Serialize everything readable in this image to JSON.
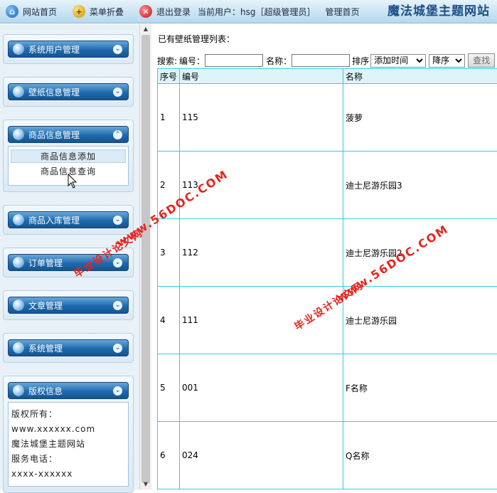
{
  "topbar": {
    "home_label": "网站首页",
    "fold_label": "菜单折叠",
    "logout_label": "退出登录",
    "current_user_label": "当前用户：hsg［超级管理员］",
    "admin_home_label": "管理首页",
    "site_title": "魔法城堡主题网站"
  },
  "sidebar": {
    "menus": [
      {
        "label": "系统用户管理"
      },
      {
        "label": "壁纸信息管理"
      },
      {
        "label": "商品信息管理",
        "sub_items": [
          "商品信息添加",
          "商品信息查询"
        ]
      },
      {
        "label": "商品入库管理"
      },
      {
        "label": "订单管理"
      },
      {
        "label": "文章管理"
      },
      {
        "label": "系统管理"
      },
      {
        "label": "版权信息"
      }
    ],
    "copyright": {
      "line1": "版权所有：",
      "line2": "www.xxxxxx.com",
      "line3": "魔法城堡主题网站",
      "line4": "服务电话：",
      "line5": "xxxx-xxxxxx"
    }
  },
  "main": {
    "list_title": "已有壁纸管理列表：",
    "search": {
      "label": "搜索:",
      "code_label": "编号：",
      "code_value": "",
      "name_label": "名称：",
      "name_value": "",
      "sort_label": "排序",
      "sort_field": "添加时间",
      "sort_order": "降序",
      "search_button": "查找"
    },
    "table": {
      "headers": [
        "序号",
        "编号",
        "名称"
      ],
      "rows": [
        {
          "seq": "1",
          "code": "115",
          "name": "菠萝"
        },
        {
          "seq": "2",
          "code": "113",
          "name": "迪士尼游乐园3"
        },
        {
          "seq": "3",
          "code": "112",
          "name": "迪士尼游乐园2"
        },
        {
          "seq": "4",
          "code": "111",
          "name": "迪士尼游乐园"
        },
        {
          "seq": "5",
          "code": "001",
          "name": "F名称"
        },
        {
          "seq": "6",
          "code": "024",
          "name": "Q名称"
        }
      ]
    }
  },
  "watermark": {
    "line1": "毕业设计论文网",
    "line2": "www.56DOC.COM",
    "color": "#e8231d"
  }
}
